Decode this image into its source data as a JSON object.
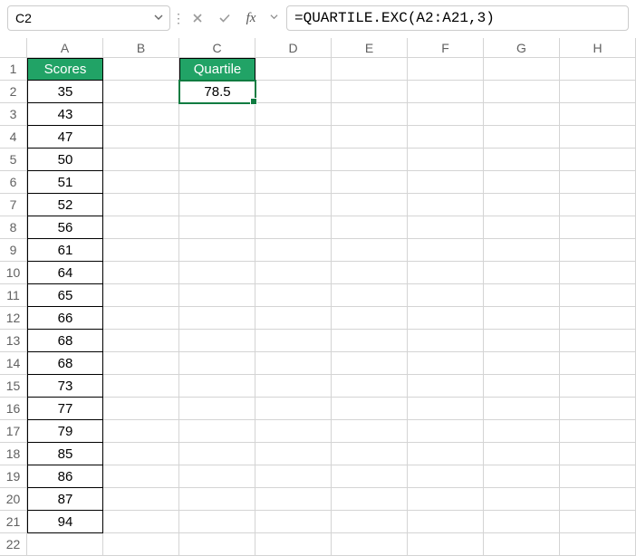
{
  "nameBox": {
    "value": "C2"
  },
  "formulaBar": {
    "fxLabel": "fx",
    "formula": "=QUARTILE.EXC(A2:A21,3)"
  },
  "columns": [
    "A",
    "B",
    "C",
    "D",
    "E",
    "F",
    "G",
    "H"
  ],
  "rowCount": 22,
  "headers": {
    "A1": "Scores",
    "C1": "Quartile"
  },
  "scores": [
    35,
    43,
    47,
    50,
    51,
    52,
    56,
    61,
    64,
    65,
    66,
    68,
    68,
    73,
    77,
    79,
    85,
    86,
    87,
    94
  ],
  "quartileResult": "78.5",
  "selectedCell": "C2"
}
